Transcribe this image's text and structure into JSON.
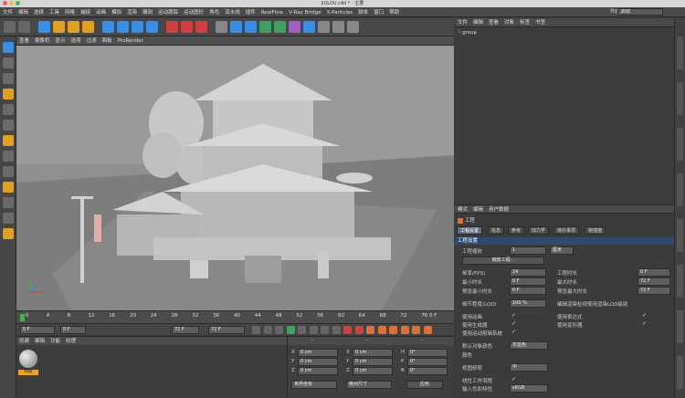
{
  "window": {
    "title": "JIULOU.c4d * - 主要"
  },
  "menubar": {
    "items": [
      "文件",
      "编辑",
      "选择",
      "工具",
      "网格",
      "捕捉",
      "动画",
      "模拟",
      "渲染",
      "雕刻",
      "运动跟踪",
      "运动图形",
      "角色",
      "流水线",
      "插件",
      "RealFlow",
      "V-Ray Bridge",
      "X-Particles",
      "脚本",
      "窗口",
      "帮助"
    ],
    "ui_label": "界面:",
    "ui_value": "启动"
  },
  "viewport": {
    "menu": [
      "查看",
      "摄像机",
      "显示",
      "选项",
      "过滤",
      "面板",
      "ProRender"
    ]
  },
  "timeline": {
    "ticks": [
      "0",
      "4",
      "8",
      "12",
      "16",
      "20",
      "24",
      "28",
      "32",
      "36",
      "40",
      "44",
      "48",
      "52",
      "56",
      "60",
      "64",
      "68",
      "72",
      "76"
    ],
    "end_label": "0 F"
  },
  "transport": {
    "current": "0 F",
    "start": "0 F",
    "end": "72 F",
    "end2": "72 F"
  },
  "material": {
    "menu": [
      "创建",
      "编辑",
      "功能",
      "纹理"
    ],
    "swatch_label": "材质"
  },
  "coords": {
    "headers": [
      "--",
      "--",
      "--"
    ],
    "rows": [
      {
        "a": "X",
        "av": "0 cm",
        "b": "X",
        "bv": "0 cm",
        "c": "H",
        "cv": "0°"
      },
      {
        "a": "Y",
        "av": "0 cm",
        "b": "Y",
        "bv": "0 cm",
        "c": "P",
        "cv": "0°"
      },
      {
        "a": "Z",
        "av": "0 cm",
        "b": "Z",
        "bv": "0 cm",
        "c": "B",
        "cv": "0°"
      }
    ],
    "mode": "世界坐标",
    "scale": "绝对尺寸",
    "apply": "应用"
  },
  "objects": {
    "menu": [
      "文件",
      "编辑",
      "查看",
      "对象",
      "标签",
      "书签"
    ],
    "items": [
      "group"
    ]
  },
  "attributes": {
    "menu": [
      "模式",
      "编辑",
      "用户数据"
    ],
    "section": "工程",
    "tabs": [
      "工程设置",
      "信息",
      "参考",
      "动力学",
      "待办事项",
      "帧插值"
    ],
    "heading": "工程设置",
    "scale_label": "工程缩放",
    "scale_value": "1",
    "scale_unit": "厘米",
    "scale_btn": "缩放工程...",
    "fps_label": "帧率(FPS)",
    "fps_value": "24",
    "len_label": "工程时长",
    "len_value": "0 F",
    "min_label": "最小时长",
    "min_value": "0 F",
    "max_label": "最大时长",
    "max_value": "72 F",
    "pmin_label": "预览最小时长",
    "pmin_value": "0 F",
    "pmax_label": "预览最大时长",
    "pmax_value": "72 F",
    "lod_label": "细节程度(LOD)",
    "lod_value": "100 %",
    "lod_render_label": "编辑渲染检视使用渲染LOD级别",
    "anim_label": "使用动画",
    "expr_label": "使用表达式",
    "gen_label": "使用生成器",
    "deform_label": "使用变形器",
    "motion_label": "使用运动剪辑系统",
    "defcolor_label": "默认对象颜色",
    "defcolor_value": "灰蓝色",
    "color_label": "颜色",
    "clip_label": "视图修剪",
    "clip_value": "中",
    "linear_label": "线性工作流程",
    "input_label": "输入色彩特性",
    "input_value": "sRGB"
  }
}
